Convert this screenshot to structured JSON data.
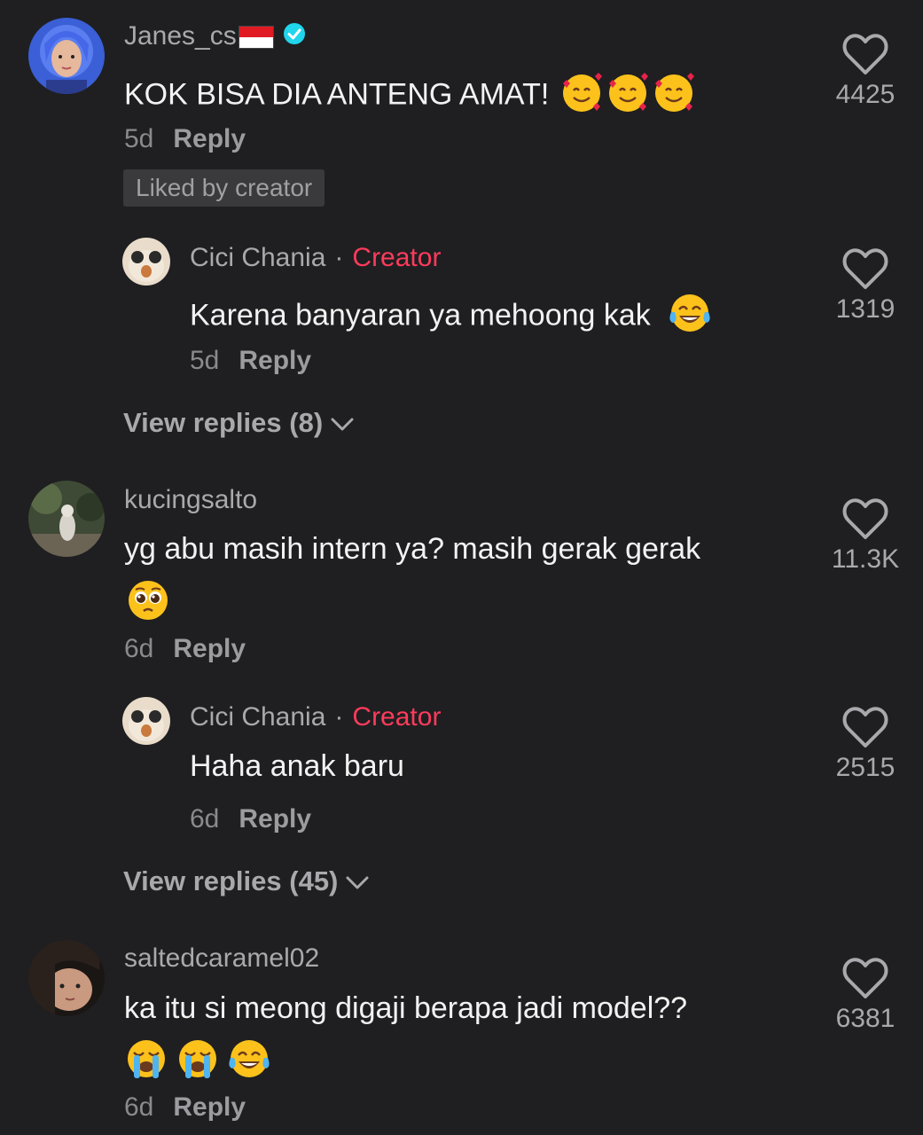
{
  "comments": [
    {
      "username": "Janes_cs",
      "text": "KOK BISA DIA ANTENG AMAT!",
      "time": "5d",
      "reply_label": "Reply",
      "badge": "Liked by creator",
      "likes": "4425",
      "emojis": [
        "smiling-face-with-hearts",
        "smiling-face-with-hearts",
        "smiling-face-with-hearts"
      ],
      "replies": [
        {
          "username": "Cici Chania",
          "separator": "·",
          "tag": "Creator",
          "text": "Karena banyaran ya mehoong kak",
          "time": "5d",
          "reply_label": "Reply",
          "likes": "1319",
          "emojis": [
            "face-with-tears-of-joy"
          ]
        }
      ],
      "view_replies": "View replies (8)"
    },
    {
      "username": "kucingsalto",
      "text": "yg abu masih intern ya? masih gerak gerak",
      "time": "6d",
      "reply_label": "Reply",
      "likes": "11.3K",
      "emojis": [
        "pleading-face"
      ],
      "replies": [
        {
          "username": "Cici Chania",
          "separator": "·",
          "tag": "Creator",
          "text": "Haha anak baru",
          "time": "6d",
          "reply_label": "Reply",
          "likes": "2515"
        }
      ],
      "view_replies": "View replies (45)"
    },
    {
      "username": "saltedcaramel02",
      "text": "ka itu si meong digaji berapa jadi model??",
      "time": "6d",
      "reply_label": "Reply",
      "likes": "6381",
      "emojis": [
        "loudly-crying-face",
        "loudly-crying-face",
        "face-with-tears-of-joy"
      ]
    }
  ],
  "colors": {
    "background": "#1f1f21",
    "creator": "#ff3b5c",
    "verified": "#20d5ec",
    "muted": "#a9a9ad"
  }
}
